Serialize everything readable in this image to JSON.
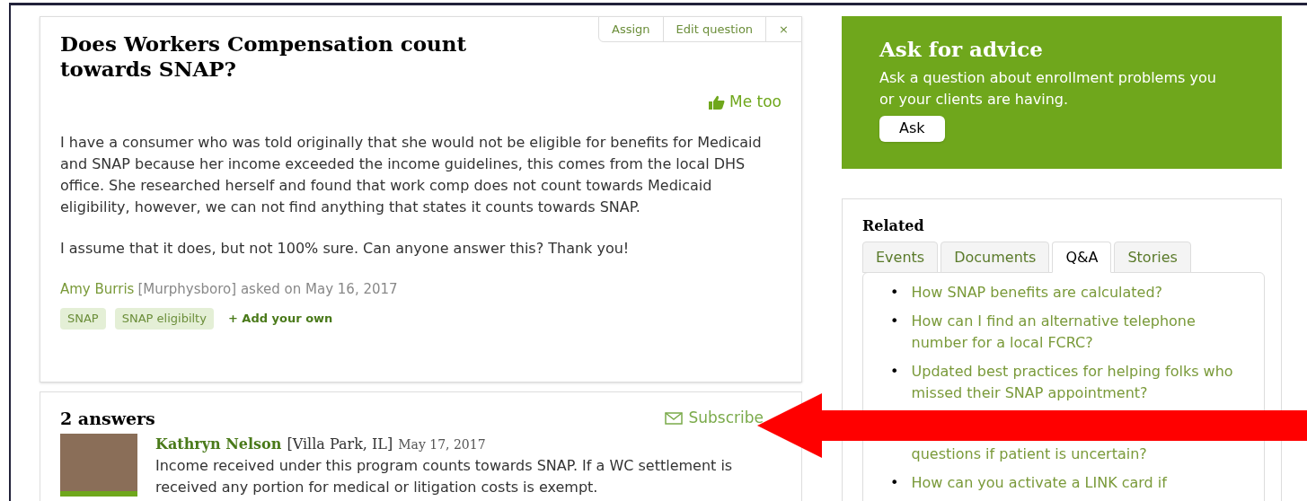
{
  "question": {
    "actions": [
      "Assign",
      "Edit question",
      "×"
    ],
    "title": "Does Workers Compensation count towards SNAP?",
    "me_too": "Me too",
    "body": [
      "I have a consumer who was told originally that she would not be eligible for benefits for Medicaid and SNAP because her income exceeded the income guidelines, this comes from the local DHS office. She researched herself and found that work comp does not count towards Medicaid eligibility, however, we can not find anything that states it counts towards SNAP.",
      "I assume that it does, but not 100% sure. Can anyone answer this? Thank you!"
    ],
    "author": "Amy Burris",
    "byline": "[Murphysboro] asked on May 16, 2017",
    "tags": [
      "SNAP",
      "SNAP eligibilty"
    ],
    "add_tag": "+ Add your own"
  },
  "answers": {
    "heading": "2 answers",
    "subscribe": "Subscribe",
    "items": [
      {
        "name": "Kathryn Nelson",
        "location": "[Villa Park, IL]",
        "date": "May 17, 2017",
        "text": "Income received under this program counts towards SNAP.  If a WC settlement is received any portion for medical or litigation costs is exempt."
      }
    ]
  },
  "ask": {
    "title": "Ask for advice",
    "text": "Ask a question about enrollment problems you or your clients are having.",
    "button": "Ask"
  },
  "related": {
    "title": "Related",
    "tabs": [
      {
        "label": "Events",
        "selected": false
      },
      {
        "label": "Documents",
        "selected": false
      },
      {
        "label": "Q&A",
        "selected": true
      },
      {
        "label": "Stories",
        "selected": false
      }
    ],
    "items": [
      {
        "kind": "item",
        "bullet": "•",
        "text": "How SNAP benefits are calculated?"
      },
      {
        "kind": "item",
        "bullet": "•",
        "text": "How can I find an alternative telephone number for a local FCRC?"
      },
      {
        "kind": "item",
        "bullet": "•",
        "text": "Updated best practices for helping folks who missed their SNAP appointment?"
      },
      {
        "kind": "covered",
        "text": "questions if patient is uncertain?"
      },
      {
        "kind": "item",
        "bullet": "•",
        "text": "How can you activate a LINK card if"
      }
    ]
  }
}
